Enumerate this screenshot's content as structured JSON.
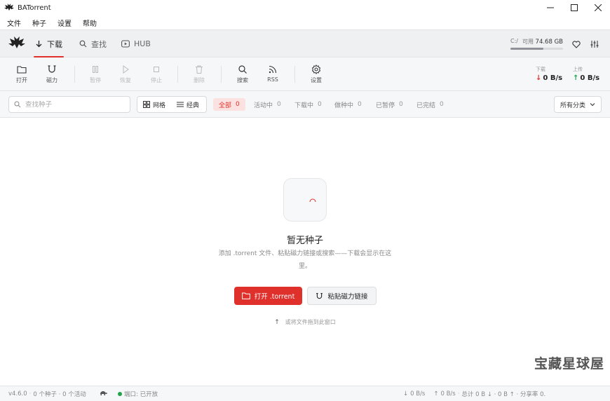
{
  "app": {
    "title": "BATorrent"
  },
  "menu": [
    "文件",
    "种子",
    "设置",
    "帮助"
  ],
  "nav": {
    "tabs": [
      {
        "label": "下载",
        "icon": "download-arrow-icon",
        "active": true
      },
      {
        "label": "查找",
        "icon": "search-icon",
        "active": false
      },
      {
        "label": "HUB",
        "icon": "play-box-icon",
        "active": false
      }
    ],
    "disk": {
      "drive": "C:/",
      "available_label": "可用",
      "available": "74.68 GB",
      "used_fraction": 0.62
    }
  },
  "toolbar": {
    "open": "打开",
    "magnet": "磁力",
    "pause": "暂停",
    "resume": "恢复",
    "stop": "停止",
    "delete": "删除",
    "search": "搜索",
    "rss": "RSS",
    "settings": "设置",
    "download_label": "下载",
    "download_speed": "0 B/s",
    "upload_label": "上传",
    "upload_speed": "0 B/s"
  },
  "filter": {
    "search_placeholder": "查找种子",
    "view_grid": "网格",
    "view_classic": "经典",
    "chips": [
      {
        "label": "全部",
        "count": "0",
        "active": true
      },
      {
        "label": "活动中",
        "count": "0",
        "active": false
      },
      {
        "label": "下载中",
        "count": "0",
        "active": false
      },
      {
        "label": "做种中",
        "count": "0",
        "active": false
      },
      {
        "label": "已暂停",
        "count": "0",
        "active": false
      },
      {
        "label": "已完结",
        "count": "0",
        "active": false
      }
    ],
    "category": "所有分类"
  },
  "empty": {
    "title": "暂无种子",
    "description": "添加 .torrent 文件、粘贴磁力链接或搜索——下载会显示在这里。",
    "open_button": "打开 .torrent",
    "paste_button": "粘贴磁力链接",
    "drag_hint": "或将文件拖到此窗口"
  },
  "watermark": "宝藏星球屋",
  "status": {
    "version": "v4.6.0",
    "torrents": "0 个种子 · 0 个活动",
    "port": "端口: 已开放",
    "down": "0 B/s",
    "up": "0 B/s",
    "totals": "总计 0 B ↓ · 0 B ↑ · 分享率 0."
  },
  "colors": {
    "accent": "#e0302b",
    "port_ok": "#22a34a"
  }
}
